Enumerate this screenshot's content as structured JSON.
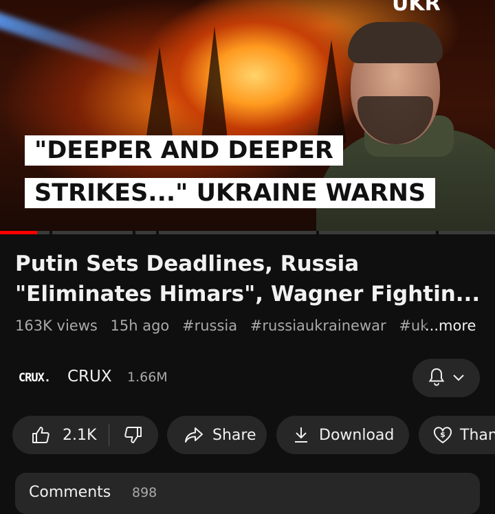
{
  "thumbnail": {
    "headline_line1": "\"DEEPER AND DEEPER",
    "headline_line2": "STRIKES...\" UKRAINE WARNS",
    "corner_text": "UKR"
  },
  "video": {
    "progress_fraction": 0.075,
    "title": "Putin Sets Deadlines, Russia \"Eliminates Himars\", Wagner Fightin...",
    "views": "163K views",
    "age": "15h ago",
    "tags": [
      "#russia",
      "#russiaukrainewar",
      "#ukra"
    ],
    "more_label": "...more"
  },
  "channel": {
    "logo_text": "CRUX.",
    "name": "CRUX",
    "subscribers": "1.66M"
  },
  "actions": {
    "likes": "2.1K",
    "share_label": "Share",
    "download_label": "Download",
    "thanks_label": "Thanks"
  },
  "comments": {
    "label": "Comments",
    "count": "898"
  },
  "colors": {
    "background": "#0f0f0f",
    "pill": "#272727",
    "progress": "#ff0000",
    "secondary_text": "#aaaaaa"
  }
}
